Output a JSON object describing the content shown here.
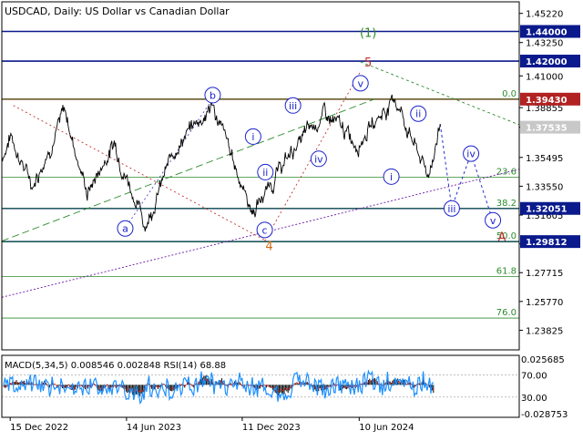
{
  "title": "USDCAD, Daily:  US Dollar vs Canadian Dollar",
  "indicator_label": "MACD(5,34,5) 0.008546 0.002848 RSI(14) 68.88",
  "chart_data": {
    "type": "line",
    "symbol": "USDCAD",
    "timeframe": "Daily",
    "title": "USDCAD, Daily:  US Dollar vs Canadian Dollar",
    "x_ticks": [
      "15 Dec 2022",
      "14 Jun 2023",
      "11 Dec 2023",
      "10 Jun 2024"
    ],
    "y_ticks": [
      "1.45220",
      "1.43250",
      "1.41000",
      "1.38855",
      "1.37535",
      "1.35495",
      "1.33550",
      "1.31605",
      "1.29660",
      "1.27715",
      "1.25770",
      "1.23825"
    ],
    "ylim": [
      1.225,
      1.46
    ],
    "price_series": {
      "start": "2022-12-02",
      "end": "2024-10-14",
      "key_points": [
        [
          "2022-12-02",
          1.355
        ],
        [
          "2022-12-16",
          1.37
        ],
        [
          "2023-01-18",
          1.336
        ],
        [
          "2023-03-10",
          1.386
        ],
        [
          "2023-04-14",
          1.331
        ],
        [
          "2023-05-26",
          1.365
        ],
        [
          "2023-07-13",
          1.3095
        ],
        [
          "2023-09-01",
          1.364
        ],
        [
          "2023-10-26",
          1.39
        ],
        [
          "2023-12-27",
          1.318
        ],
        [
          "2024-02-28",
          1.36
        ],
        [
          "2024-04-16",
          1.384
        ],
        [
          "2024-06-05",
          1.365
        ],
        [
          "2024-08-05",
          1.395
        ],
        [
          "2024-09-25",
          1.342
        ],
        [
          "2024-10-14",
          1.3775
        ]
      ]
    },
    "price_labels": [
      {
        "value": "1.44000",
        "color": "#0a1a8c"
      },
      {
        "value": "1.42000",
        "color": "#0a1a8c"
      },
      {
        "value": "1.39430",
        "color": "#b22222"
      },
      {
        "value": "1.37535",
        "color": "#c8c8c8"
      },
      {
        "value": "1.32051",
        "color": "#0a1a8c"
      },
      {
        "value": "1.29812",
        "color": "#0a1a8c"
      }
    ],
    "horizontal_levels": [
      {
        "price": 1.44,
        "color": "#0a1a8c"
      },
      {
        "price": 1.42,
        "color": "#0a1a8c"
      },
      {
        "price": 1.3943,
        "color": "#b22222"
      },
      {
        "price": 1.3205,
        "color": "#0a1a8c"
      },
      {
        "price": 1.2981,
        "color": "#0a1a8c"
      }
    ],
    "fib_levels": [
      {
        "label": "0.0",
        "price": 1.3943
      },
      {
        "label": "23.6",
        "price": 1.3415
      },
      {
        "label": "38.2",
        "price": 1.3205
      },
      {
        "label": "50.0",
        "price": 1.2981
      },
      {
        "label": "61.8",
        "price": 1.2745
      },
      {
        "label": "76.0",
        "price": 1.2465
      }
    ],
    "wave_labels": [
      {
        "text": "a",
        "date": "2023-06-12",
        "price": 1.307,
        "style": "circle"
      },
      {
        "text": "b",
        "date": "2023-10-26",
        "price": 1.397,
        "style": "circle"
      },
      {
        "text": "c",
        "date": "2024-01-15",
        "price": 1.306,
        "style": "circle"
      },
      {
        "text": "i",
        "date": "2023-12-28",
        "price": 1.369,
        "style": "circle"
      },
      {
        "text": "ii",
        "date": "2024-01-16",
        "price": 1.345,
        "style": "circle"
      },
      {
        "text": "iii",
        "date": "2024-02-28",
        "price": 1.39,
        "style": "circle"
      },
      {
        "text": "iv",
        "date": "2024-04-08",
        "price": 1.354,
        "style": "circle"
      },
      {
        "text": "v",
        "date": "2024-06-12",
        "price": 1.405,
        "style": "circle"
      },
      {
        "text": "i",
        "date": "2024-07-30",
        "price": 1.342,
        "style": "circle"
      },
      {
        "text": "ii",
        "date": "2024-09-10",
        "price": 1.3845,
        "style": "circle"
      },
      {
        "text": "iii",
        "date": "2024-11-01",
        "price": 1.3205,
        "style": "circle"
      },
      {
        "text": "iv",
        "date": "2024-12-01",
        "price": 1.3575,
        "style": "circle"
      },
      {
        "text": "v",
        "date": "2025-01-04",
        "price": 1.3125,
        "style": "circle"
      },
      {
        "text": "(1)",
        "date": "2024-06-24",
        "price": 1.4395,
        "style": "plain-green"
      },
      {
        "text": "5",
        "date": "2024-06-24",
        "price": 1.4195,
        "style": "plain-red"
      },
      {
        "text": "4",
        "date": "2024-01-22",
        "price": 1.2955,
        "style": "plain-orange"
      },
      {
        "text": "A",
        "date": "2025-01-18",
        "price": 1.3015,
        "style": "plain-red"
      }
    ],
    "indicator": {
      "name": "MACD(5,34,5) RSI(14)",
      "macd_main": 0.008546,
      "macd_signal": 0.002848,
      "rsi": 68.88,
      "left_ticks": [
        "70.00",
        "30.00"
      ],
      "right_ticks": [
        "0.025685",
        "-0.028753"
      ]
    }
  }
}
